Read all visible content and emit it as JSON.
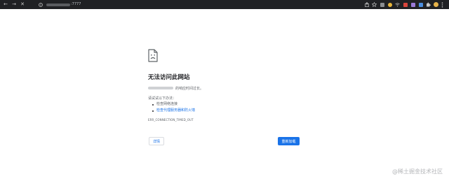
{
  "browser": {
    "url_port": ":7777",
    "buttons": {
      "back": "←",
      "forward": "→",
      "stop": "✕",
      "info": "ⓘ"
    },
    "toolbar_icons": [
      "share-icon",
      "star-icon",
      "extension-icon",
      "extension-icon",
      "wifi-icon",
      "extension-icon",
      "extension-icon",
      "puzzle-icon",
      "avatar",
      "menu-icon"
    ]
  },
  "error_page": {
    "title": "无法访问此网站",
    "description": "的响应时间过长。",
    "suggestions_heading": "请试试以下办法：",
    "suggestions": [
      "检查网络连接",
      "检查代理服务器和防火墙"
    ],
    "error_code": "ERR_CONNECTION_TIMED_OUT",
    "details_button": "详情",
    "reload_button": "重新加载"
  },
  "watermark": "@稀土掘金技术社区",
  "colors": {
    "chrome_bg": "#202124",
    "primary_blue": "#1a73e8",
    "text": "#202124",
    "secondary_text": "#5f6368"
  }
}
